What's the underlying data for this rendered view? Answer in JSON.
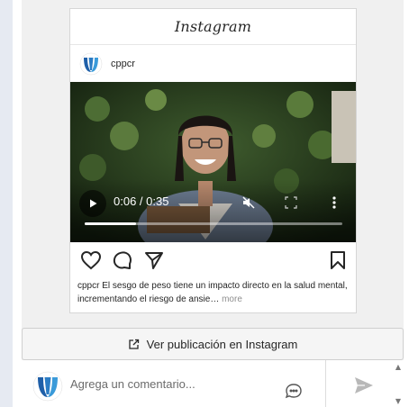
{
  "embed": {
    "brand": "Instagram",
    "username": "cppcr",
    "video": {
      "time": "0:06 / 0:35",
      "progress": 0.2
    },
    "caption": {
      "user": "cppcr",
      "text": " El sesgo de peso tiene un impacto directo en la salud mental, incrementando el riesgo de ansie…",
      "more": " more"
    }
  },
  "view_button": {
    "label": "Ver publicación en Instagram"
  },
  "comment": {
    "placeholder": "Agrega un comentario..."
  },
  "colors": {
    "logo_blue": "#1f5fa8",
    "logo_cyan": "#3a9ad9",
    "panel_bg": "#f0f0f0"
  }
}
